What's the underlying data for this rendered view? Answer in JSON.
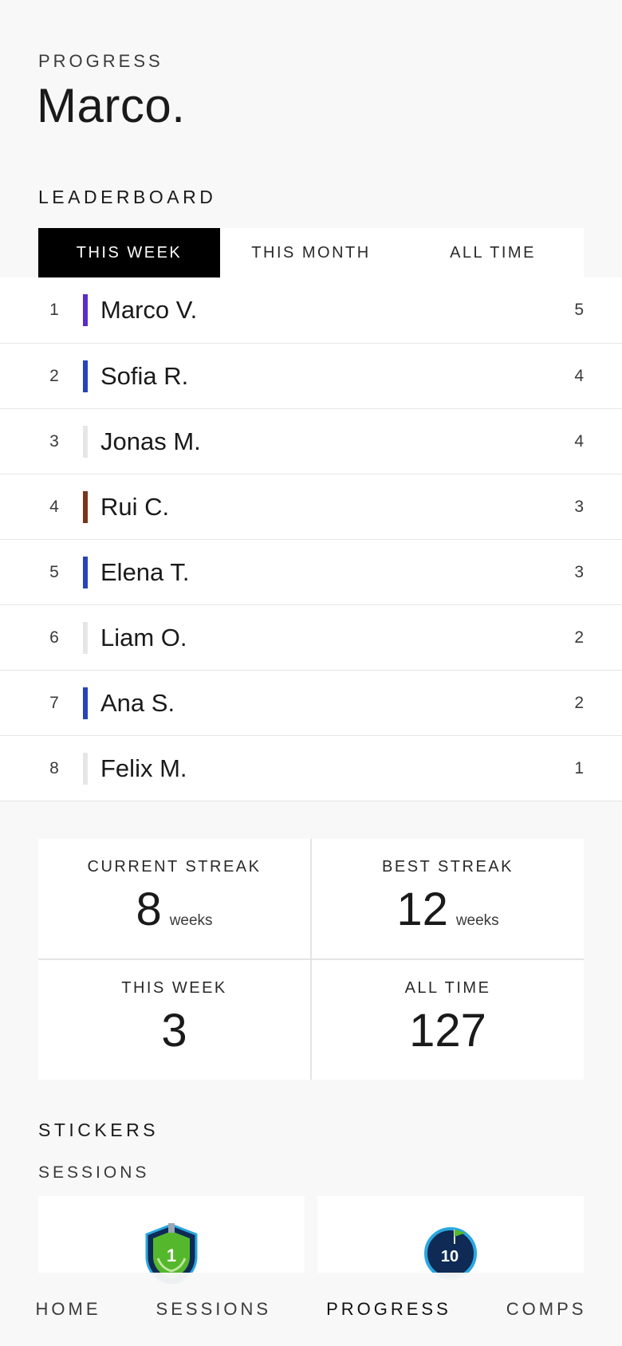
{
  "header": {
    "eyebrow": "PROGRESS",
    "title": "Marco."
  },
  "leaderboard": {
    "heading": "LEADERBOARD",
    "tabs": [
      {
        "label": "THIS WEEK",
        "active": true
      },
      {
        "label": "THIS MONTH",
        "active": false
      },
      {
        "label": "ALL TIME",
        "active": false
      }
    ],
    "rows": [
      {
        "rank": "1",
        "name": "Marco V.",
        "score": "5",
        "color": "#5b2bc9"
      },
      {
        "rank": "2",
        "name": "Sofia R.",
        "score": "4",
        "color": "#2444b8"
      },
      {
        "rank": "3",
        "name": "Jonas M.",
        "score": "4",
        "color": "#e6e6e6"
      },
      {
        "rank": "4",
        "name": "Rui C.",
        "score": "3",
        "color": "#7a3418"
      },
      {
        "rank": "5",
        "name": "Elena T.",
        "score": "3",
        "color": "#2444b8"
      },
      {
        "rank": "6",
        "name": "Liam O.",
        "score": "2",
        "color": "#e6e6e6"
      },
      {
        "rank": "7",
        "name": "Ana S.",
        "score": "2",
        "color": "#2444b8"
      },
      {
        "rank": "8",
        "name": "Felix M.",
        "score": "1",
        "color": "#e6e6e6"
      }
    ]
  },
  "stats": [
    {
      "label": "CURRENT STREAK",
      "value": "8",
      "unit": "weeks"
    },
    {
      "label": "BEST STREAK",
      "value": "12",
      "unit": "weeks"
    },
    {
      "label": "THIS WEEK",
      "value": "3",
      "unit": ""
    },
    {
      "label": "ALL TIME",
      "value": "127",
      "unit": ""
    }
  ],
  "stickers": {
    "heading": "STICKERS",
    "subheading": "SESSIONS",
    "items": [
      {
        "icon": "first-session-shield-icon",
        "label": "1"
      },
      {
        "icon": "ten-sessions-flag-icon",
        "label": "10"
      }
    ]
  },
  "nav": {
    "items": [
      {
        "label": "HOME",
        "active": false
      },
      {
        "label": "SESSIONS",
        "active": false
      },
      {
        "label": "PROGRESS",
        "active": true
      },
      {
        "label": "COMPS",
        "active": false
      }
    ]
  }
}
